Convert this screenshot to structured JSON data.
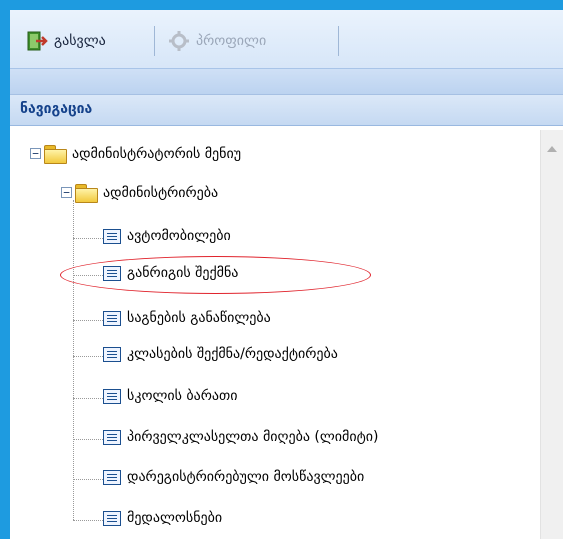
{
  "toolbar": {
    "exit_label": "გასვლა",
    "profile_label": "პროფილი"
  },
  "nav": {
    "header": "ნავიგაცია",
    "root": {
      "label": "ადმინისტრატორის მენიუ"
    },
    "folder": {
      "label": "ადმინისტრირება"
    },
    "items": [
      {
        "label": "ავტომობილები"
      },
      {
        "label": "განრიგის შექმნა",
        "highlighted": true
      },
      {
        "label": "საგნების განაწილება"
      },
      {
        "label": "კლასების შექმნა/რედაქტირება"
      },
      {
        "label": "სკოლის ბარათი"
      },
      {
        "label": "პირველკლასელთა მიღება (ლიმიტი)"
      },
      {
        "label": "დარეგისტრირებული მოსწავლეები"
      },
      {
        "label": "მედალოსნები"
      }
    ]
  },
  "colors": {
    "frame": "#1e9be0",
    "highlight": "#e0232c",
    "header_text": "#15428b"
  },
  "icons": {
    "exit": "exit-door-icon",
    "profile": "gear-icon",
    "folder": "folder-icon",
    "page": "page-icon"
  }
}
